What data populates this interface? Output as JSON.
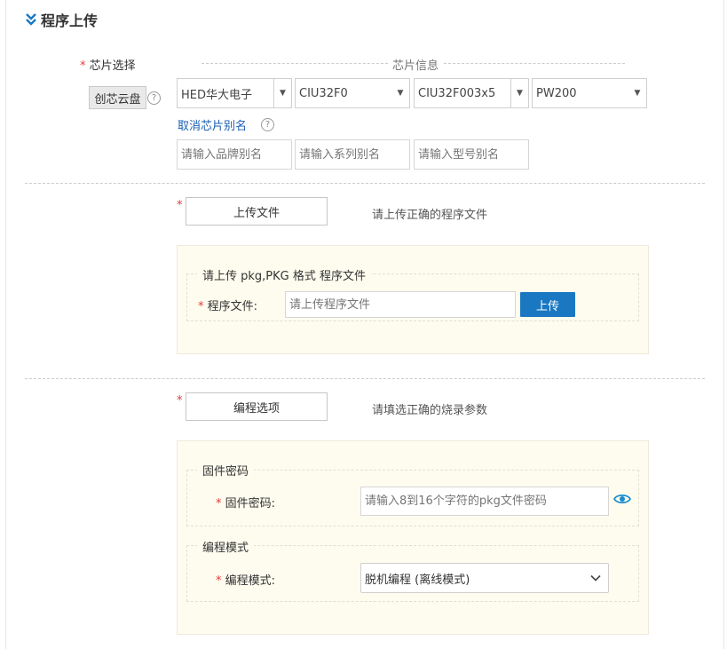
{
  "section": {
    "title": "程序上传",
    "collapse_icon": "double-chevron-down-icon"
  },
  "chip": {
    "label": "芯片选择",
    "info_title": "芯片信息",
    "cloud_button": "创芯云盘",
    "help_glyph": "?",
    "brand": "HED华大电子",
    "series": "CIU32F0",
    "model": "CIU32F003x5",
    "package": "PW200",
    "cancel_alias_link": "取消芯片别名",
    "brand_alias_placeholder": "请输入品牌别名",
    "series_alias_placeholder": "请输入系列别名",
    "model_alias_placeholder": "请输入型号别名"
  },
  "upload": {
    "button": "上传文件",
    "hint": "请上传正确的程序文件",
    "legend": "请上传 pkg,PKG 格式 程序文件",
    "file_label": "程序文件:",
    "file_placeholder": "请上传程序文件",
    "upload_button": "上传"
  },
  "options": {
    "button": "编程选项",
    "hint": "请填选正确的烧录参数",
    "firmware_legend": "固件密码",
    "firmware_label": "固件密码:",
    "firmware_placeholder": "请输入8到16个字符的pkg文件密码",
    "mode_legend": "编程模式",
    "mode_label": "编程模式:",
    "mode_value": "脱机编程 (离线模式)"
  },
  "colors": {
    "accent": "#1a78c2",
    "required": "#e4393c",
    "panel": "#fefcee",
    "link": "#1a5fb4"
  }
}
